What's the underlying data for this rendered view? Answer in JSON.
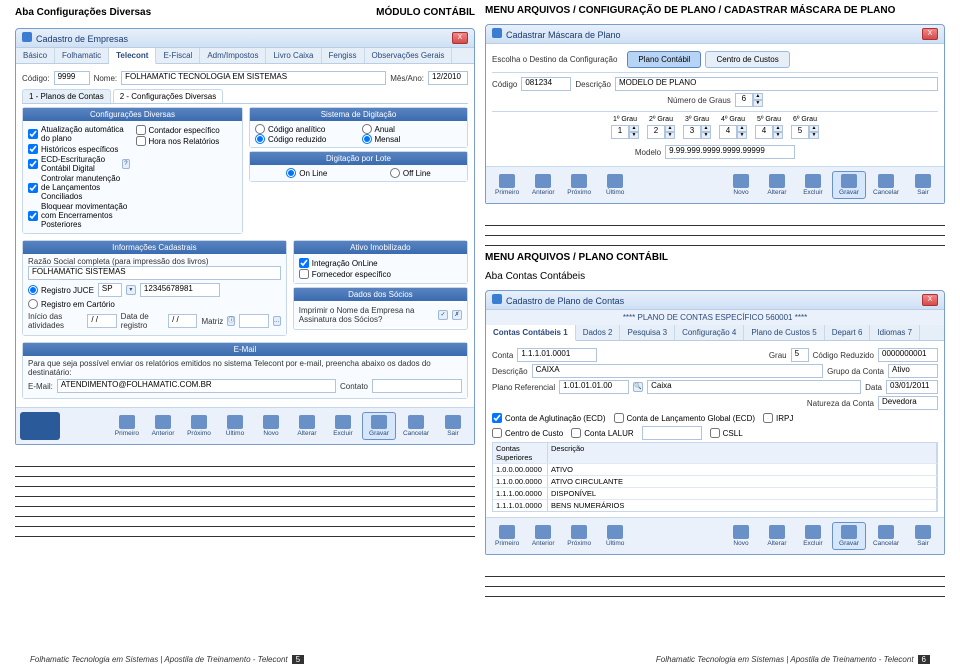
{
  "left": {
    "headerLeft": "Aba Configurações Diversas",
    "headerRight": "MÓDULO CONTÁBIL",
    "win1": {
      "title": "Cadastro de Empresas",
      "close": "X",
      "tabs": [
        "Básico",
        "Folhamatic",
        "Telecont",
        "E-Fiscal",
        "Adm/Impostos",
        "Livro Caixa",
        "Fengiss",
        "Observações Gerais"
      ],
      "codigoLbl": "Código:",
      "codigo": "9999",
      "nomeLbl": "Nome:",
      "nome": "FOLHAMATIC TECNOLOGIA EM SISTEMAS",
      "mesAnoLbl": "Mês/Ano:",
      "mesAno": "12/2010",
      "subtabs": [
        "1 - Planos de Contas",
        "2 - Configurações Diversas"
      ],
      "gDiv": "Configurações Diversas",
      "gSist": "Sistema de Digitação",
      "cbs": [
        "Atualização automática do plano",
        "Históricos específicos",
        "ECD-Escrituração Contábil Digital",
        "Controlar manutenção de Lançamentos Conciliados",
        "Bloquear movimentação com Encerramentos Posteriores"
      ],
      "cbs2": [
        "Contador específico",
        "Hora nos Relatórios"
      ],
      "rSist1a": "Código analítico",
      "rSist1b": "Código reduzido",
      "rSist2a": "Anual",
      "rSist2b": "Mensal",
      "gLote": "Digitação por Lote",
      "rLote1": "On Line",
      "rLote2": "Off Line",
      "gCad": "Informações Cadastrais",
      "gAtivo": "Ativo Imobilizado",
      "razaoLbl": "Razão Social completa (para impressão dos livros)",
      "razao": "FOLHAMATIC SISTEMAS",
      "regJuceLbl": "Registro JUCE",
      "regJuceUF": "SP",
      "regJuceNum": "12345678981",
      "regCartLbl": "Registro em Cartório",
      "cbAtivo1": "Integração OnLine",
      "cbAtivo2": "Fornecedor específico",
      "gSocios": "Dados dos Sócios",
      "inicioLbl": "Início das atividades",
      "dt": "/ /",
      "dataRegLbl": "Data de registro",
      "matrizLbl": "Matriz",
      "sociosTxt": "Imprimir o Nome da Empresa na Assinatura dos Sócios?",
      "gEmail": "E-Mail",
      "emailTxt": "Para que seja possível enviar os relatórios emitidos no sistema Telecont por e-mail, preencha abaixo os dados do destinatário:",
      "emailLbl": "E-Mail:",
      "email": "ATENDIMENTO@FOLHAMATIC.COM.BR",
      "contatoLbl": "Contato",
      "toolbar": [
        "Primeiro",
        "Anterior",
        "Próximo",
        "Último",
        "Novo",
        "Alterar",
        "Excluir",
        "Gravar",
        "Cancelar",
        "Sair"
      ]
    }
  },
  "right": {
    "h1": "MENU ARQUIVOS / CONFIGURAÇÃO DE PLANO / CADASTRAR MÁSCARA DE PLANO",
    "win2": {
      "title": "Cadastrar Máscara de Plano",
      "close": "X",
      "destLbl": "Escolha o Destino da Configuração",
      "dest1": "Plano Contábil",
      "dest2": "Centro de Custos",
      "codLbl": "Código",
      "cod": "081234",
      "descLbl": "Descrição",
      "desc": "MODELO DE PLANO",
      "numGrausLbl": "Número de Graus",
      "numGraus": "6",
      "grauLbls": [
        "1º Grau",
        "2º Grau",
        "3º Grau",
        "4º Grau",
        "5º Grau",
        "6º Grau"
      ],
      "grauVals": [
        "1",
        "2",
        "3",
        "4",
        "4",
        "5"
      ],
      "modeloLbl": "Modelo",
      "modelo": "9.99.999.9999.9999.99999",
      "toolbar": [
        "Primeiro",
        "Anterior",
        "Próximo",
        "Último",
        "Novo",
        "Alterar",
        "Excluir",
        "Gravar",
        "Cancelar",
        "Sair"
      ]
    },
    "h2": "MENU ARQUIVOS / PLANO CONTÁBIL",
    "h3": "Aba Contas Contábeis",
    "win3": {
      "title": "Cadastro de Plano de Contas",
      "close": "X",
      "subtitle": "**** PLANO DE CONTAS ESPECÍFICO 560001 ****",
      "tabs": [
        "Contas Contábeis 1",
        "Dados 2",
        "Pesquisa 3",
        "Configuração 4",
        "Plano de Custos 5",
        "Depart 6",
        "Idiomas 7"
      ],
      "contaLbl": "Conta",
      "conta": "1.1.1.01.0001",
      "grauLbl": "Grau",
      "grau": "5",
      "codRedLbl": "Código Reduzido",
      "codRed": "0000000001",
      "descLbl": "Descrição",
      "desc": "CAIXA",
      "grupoLbl": "Grupo da Conta",
      "grupo": "Ativo",
      "planoRefLbl": "Plano Referencial",
      "planoRef": "1.01.01.01.00",
      "planoRefDesc": "Caixa",
      "dataLbl": "Data",
      "data": "03/01/2011",
      "naturezaLbl": "Natureza da Conta",
      "natureza": "Devedora",
      "cb1": "Conta de Aglutinação (ECD)",
      "cb2": "Conta de Lançamento Global (ECD)",
      "cb3": "IRPJ",
      "cb4": "Centro de Custo",
      "cb5": "Conta LALUR",
      "cb6": "CSLL",
      "cSupLbl": "Contas Superiores",
      "cDescLbl": "Descrição",
      "rows": [
        [
          "1.0.0.00.0000",
          "ATIVO"
        ],
        [
          "1.1.0.00.0000",
          "ATIVO CIRCULANTE"
        ],
        [
          "1.1.1.00.0000",
          "DISPONÍVEL"
        ],
        [
          "1.1.1.01.0000",
          "BENS NUMERÁRIOS"
        ]
      ],
      "toolbar": [
        "Primeiro",
        "Anterior",
        "Próximo",
        "Último",
        "Novo",
        "Alterar",
        "Excluir",
        "Gravar",
        "Cancelar",
        "Sair"
      ]
    }
  },
  "footer": {
    "txt": "Folhamatic Tecnologia em Sistemas | Apostila de Treinamento - Telecont",
    "p1": "5",
    "p2": "6"
  }
}
